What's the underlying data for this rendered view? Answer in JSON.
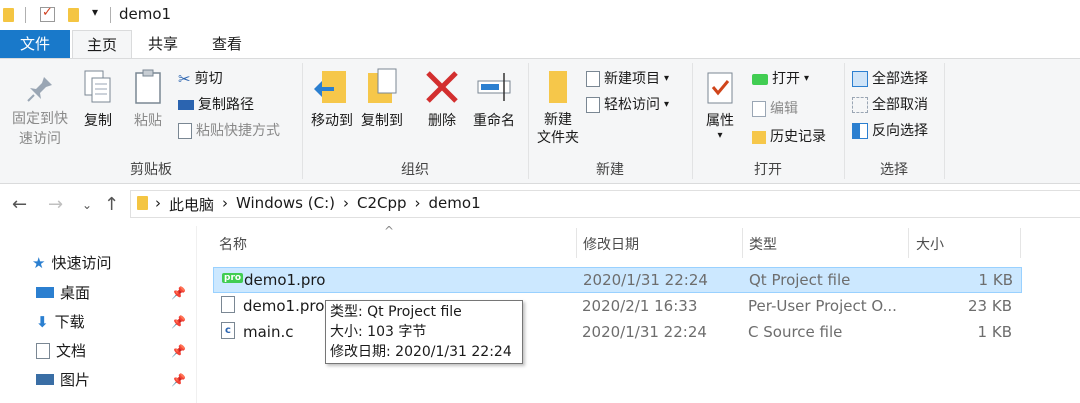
{
  "window": {
    "title": "demo1"
  },
  "ribbon_tabs": [
    "文件",
    "主页",
    "共享",
    "查看"
  ],
  "ribbon": {
    "clipboard": {
      "label": "剪贴板",
      "pin_quick_access": [
        "固定到快",
        "速访问"
      ],
      "copy": "复制",
      "paste": "粘贴",
      "cut": "剪切",
      "copy_path": "复制路径",
      "paste_shortcut": "粘贴快捷方式"
    },
    "organize": {
      "label": "组织",
      "move_to": "移动到",
      "copy_to": "复制到",
      "delete": "删除",
      "rename": "重命名"
    },
    "new": {
      "label": "新建",
      "new_folder": [
        "新建",
        "文件夹"
      ],
      "new_item": "新建项目",
      "easy_access": "轻松访问"
    },
    "open": {
      "label": "打开",
      "properties": "属性",
      "open": "打开",
      "edit": "编辑",
      "history": "历史记录"
    },
    "select": {
      "label": "选择",
      "select_all": "全部选择",
      "select_none": "全部取消",
      "invert": "反向选择"
    }
  },
  "address": {
    "crumbs": [
      "此电脑",
      "Windows (C:)",
      "C2Cpp",
      "demo1"
    ]
  },
  "sidebar": {
    "quick_access": "快速访问",
    "items": [
      "桌面",
      "下载",
      "文档",
      "图片"
    ]
  },
  "columns": {
    "name": "名称",
    "modified": "修改日期",
    "type": "类型",
    "size": "大小"
  },
  "files": [
    {
      "name": "demo1.pro",
      "modified": "2020/1/31 22:24",
      "type": "Qt Project file",
      "size": "1 KB"
    },
    {
      "name": "demo1.pro.",
      "modified": "2020/2/1 16:33",
      "type": "Per-User Project O...",
      "size": "23 KB"
    },
    {
      "name": "main.c",
      "modified": "2020/1/31 22:24",
      "type": "C Source file",
      "size": "1 KB"
    }
  ],
  "tooltip": {
    "type": "类型: Qt Project file",
    "size": "大小: 103 字节",
    "modified": "修改日期: 2020/1/31 22:24"
  },
  "colors": {
    "accent": "#1979ca",
    "selection": "#cce8ff",
    "delete_red": "#d32f2f"
  },
  "icons": [
    "folder-icon",
    "checkbox-icon",
    "pin-icon",
    "copy-icon",
    "paste-icon",
    "scissors-icon",
    "move-to-icon",
    "copy-to-icon",
    "delete-icon",
    "rename-icon",
    "new-folder-icon",
    "properties-icon",
    "select-all-icon",
    "star-icon",
    "desktop-icon",
    "download-icon",
    "document-icon",
    "picture-icon",
    "qt-pro-icon",
    "vs-file-icon",
    "c-file-icon"
  ]
}
